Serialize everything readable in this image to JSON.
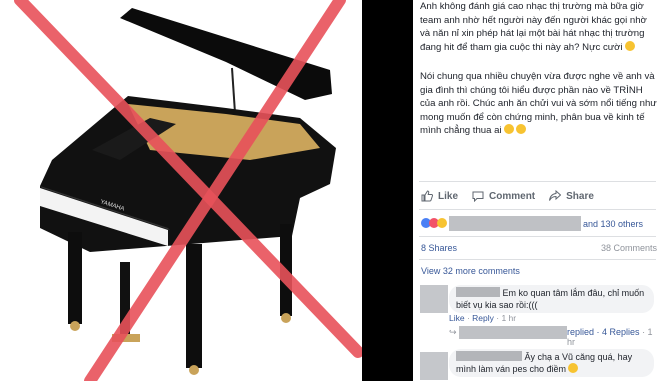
{
  "photo": {
    "brand": "YAMAHA",
    "cross_color": "#e8525a",
    "piano_color": "#0b0b0b",
    "trim_color": "#c9a35a"
  },
  "post": {
    "caption_1": "Anh không đánh giá cao nhạc thị trường mà bữa giờ team anh nhờ hết người này đến người khác gọi nhờ và năn nỉ xin phép hát lại một bài hát nhạc thị trường đang hit để tham gia cuộc thi này ah? Nực cười",
    "caption_2": "Nói chung qua nhiều chuyện vừa được nghe về anh và gia đình thì chúng tôi hiểu được phần nào về TRÌNH của anh rồi. Chúc anh ăn chửi vui và sớm nổi tiếng như mong muốn để còn chứng minh, phân bua về kinh tế mình chẳng thua ai"
  },
  "actions": {
    "like": "Like",
    "comment": "Comment",
    "share": "Share",
    "icon_color": "#606770"
  },
  "reactions": {
    "others": "and 130 others",
    "like_color": "#4a80f5",
    "love_color": "#f25268",
    "haha_color": "#f7c331"
  },
  "counts": {
    "shares": "8 Shares",
    "comments": "38 Comments"
  },
  "comments": {
    "view_more": "View 32 more comments",
    "c1": {
      "text": "Em ko quan tâm lắm đâu, chỉ muốn biết vụ kia sao rồi:(((",
      "like": "Like",
      "sep1": " · ",
      "reply": "Reply",
      "sep2": " · ",
      "time": "1 hr"
    },
    "reply_summary": {
      "arrow": "↪",
      "text": "replied · 4 Replies",
      "time": "· 1 hr"
    },
    "c2": {
      "text": "Ây chạ a Vũ căng quá, hay mình làm ván pes cho điềm"
    }
  }
}
